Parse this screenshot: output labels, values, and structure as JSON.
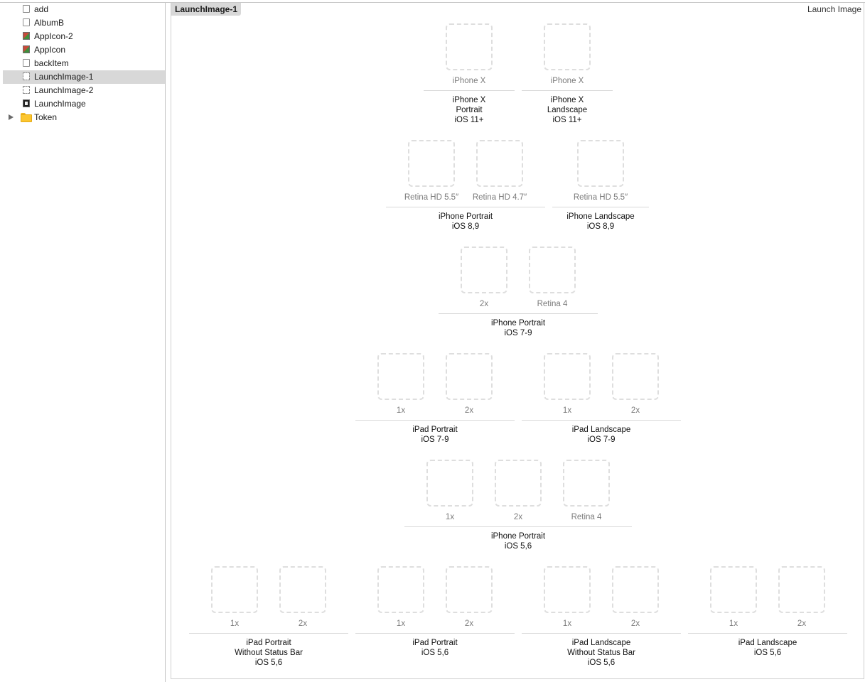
{
  "sidebar": {
    "items": [
      {
        "label": "add",
        "icon": "blank-image-icon"
      },
      {
        "label": "AlbumB",
        "icon": "blank-image-icon"
      },
      {
        "label": "AppIcon-2",
        "icon": "app-icon-set-icon"
      },
      {
        "label": "AppIcon",
        "icon": "app-icon-set-icon"
      },
      {
        "label": "backItem",
        "icon": "blank-image-icon"
      },
      {
        "label": "LaunchImage-1",
        "icon": "launch-image-empty-icon",
        "selected": true
      },
      {
        "label": "LaunchImage-2",
        "icon": "launch-image-empty-icon"
      },
      {
        "label": "LaunchImage",
        "icon": "launch-image-icon"
      },
      {
        "label": "Token",
        "icon": "folder-icon",
        "disclosure": "collapsed"
      }
    ]
  },
  "main": {
    "set_name": "LaunchImage-1",
    "set_type": "Launch Image",
    "groups": [
      {
        "title": [
          "iPhone X",
          "Portrait",
          "iOS 11+"
        ],
        "slots": [
          "iPhone X"
        ]
      },
      {
        "title": [
          "iPhone X",
          "Landscape",
          "iOS 11+"
        ],
        "slots": [
          "iPhone X"
        ]
      },
      {
        "title": [
          "iPhone Portrait",
          "iOS 8,9"
        ],
        "slots": [
          "Retina HD 5.5″",
          "Retina HD 4.7″"
        ]
      },
      {
        "title": [
          "iPhone Landscape",
          "iOS 8,9"
        ],
        "slots": [
          "Retina HD 5.5″"
        ]
      },
      {
        "title": [
          "iPhone Portrait",
          "iOS 7-9"
        ],
        "slots": [
          "2x",
          "Retina 4"
        ]
      },
      {
        "title": [
          "iPad Portrait",
          "iOS 7-9"
        ],
        "slots": [
          "1x",
          "2x"
        ]
      },
      {
        "title": [
          "iPad Landscape",
          "iOS 7-9"
        ],
        "slots": [
          "1x",
          "2x"
        ]
      },
      {
        "title": [
          "iPhone Portrait",
          "iOS 5,6"
        ],
        "slots": [
          "1x",
          "2x",
          "Retina 4"
        ]
      },
      {
        "title": [
          "iPad Portrait",
          "Without Status Bar",
          "iOS 5,6"
        ],
        "slots": [
          "1x",
          "2x"
        ]
      },
      {
        "title": [
          "iPad Portrait",
          "iOS 5,6"
        ],
        "slots": [
          "1x",
          "2x"
        ]
      },
      {
        "title": [
          "iPad Landscape",
          "Without Status Bar",
          "iOS 5,6"
        ],
        "slots": [
          "1x",
          "2x"
        ]
      },
      {
        "title": [
          "iPad Landscape",
          "iOS 5,6"
        ],
        "slots": [
          "1x",
          "2x"
        ]
      }
    ]
  },
  "colors": {
    "selection": "#d8d8d8",
    "slot_border": "#dedede",
    "folder": "#fcc630"
  }
}
